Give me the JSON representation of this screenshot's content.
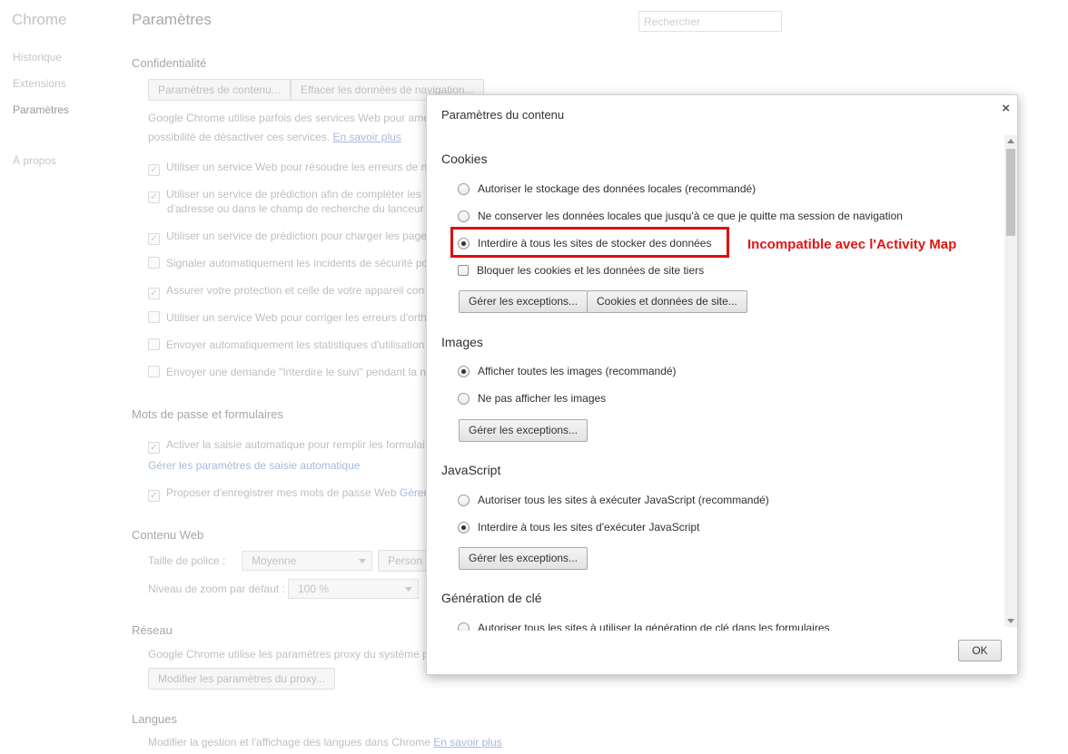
{
  "sidebar": {
    "title": "Chrome",
    "items": [
      {
        "label": "Historique"
      },
      {
        "label": "Extensions"
      },
      {
        "label": "Paramètres"
      },
      {
        "label": "À propos"
      }
    ]
  },
  "header": {
    "title": "Paramètres",
    "search_placeholder": "Rechercher"
  },
  "privacy": {
    "title": "Confidentialité",
    "content_settings_btn": "Paramètres de contenu...",
    "clear_data_btn": "Effacer les données de navigation...",
    "desc_line1": "Google Chrome utilise parfois des services Web pour amé",
    "desc_line2": "possibilité de désactiver ces services.",
    "learn_more": "En savoir plus",
    "checkboxes": [
      {
        "label": "Utiliser un service Web pour résoudre les erreurs de n",
        "checked": true
      },
      {
        "label": "Utiliser un service de prédiction afin de compléter les",
        "label2": "d'adresse ou dans le champ de recherche du lanceur d'",
        "checked": true
      },
      {
        "label": "Utiliser un service de prédiction pour charger les page",
        "checked": true
      },
      {
        "label": "Signaler automatiquement les incidents de sécurité po",
        "checked": false
      },
      {
        "label": "Assurer votre protection et celle de votre appareil con",
        "checked": true
      },
      {
        "label": "Utiliser un service Web pour corriger les erreurs d'orth",
        "checked": false
      },
      {
        "label": "Envoyer automatiquement les statistiques d'utilisation",
        "checked": false
      },
      {
        "label": "Envoyer une demande \"Interdire le suivi\" pendant la n",
        "checked": false
      }
    ]
  },
  "passwords": {
    "title": "Mots de passe et formulaires",
    "autofill_label": "Activer la saisie automatique pour remplir les formulai",
    "autofill_link": "Gérer les paramètres de saisie automatique",
    "save_pw_label": "Proposer d'enregistrer mes mots de passe Web",
    "save_pw_link": "Gérer"
  },
  "webcontent": {
    "title": "Contenu Web",
    "font_size_label": "Taille de police :",
    "font_size_value": "Moyenne",
    "custom_btn": "Person",
    "zoom_label": "Niveau de zoom par défaut :",
    "zoom_value": "100 %"
  },
  "network": {
    "title": "Réseau",
    "desc": "Google Chrome utilise les paramètres proxy du système p",
    "proxy_btn": "Modifier les paramètres du proxy..."
  },
  "languages": {
    "title": "Langues",
    "desc": "Modifier la gestion et l'affichage des langues dans Chrome",
    "link": "En savoir plus"
  },
  "dialog": {
    "title": "Paramètres du contenu",
    "close_glyph": "×",
    "ok_label": "OK",
    "cookies": {
      "title": "Cookies",
      "options": [
        {
          "label": "Autoriser le stockage des données locales (recommandé)",
          "selected": false
        },
        {
          "label": "Ne conserver les données locales que jusqu'à ce que je quitte ma session de navigation",
          "selected": false
        },
        {
          "label": "Interdire à tous les sites de stocker des données",
          "selected": true
        }
      ],
      "block_third_party": "Bloquer les cookies et les données de site tiers",
      "block_third_party_checked": false,
      "exceptions_btn": "Gérer les exceptions...",
      "site_data_btn": "Cookies et données de site..."
    },
    "images": {
      "title": "Images",
      "options": [
        {
          "label": "Afficher toutes les images (recommandé)",
          "selected": true
        },
        {
          "label": "Ne pas afficher les images",
          "selected": false
        }
      ],
      "exceptions_btn": "Gérer les exceptions..."
    },
    "javascript": {
      "title": "JavaScript",
      "options": [
        {
          "label": "Autoriser tous les sites à exécuter JavaScript (recommandé)",
          "selected": false
        },
        {
          "label": "Interdire à tous les sites d'exécuter JavaScript",
          "selected": true
        }
      ],
      "exceptions_btn": "Gérer les exceptions..."
    },
    "keygen": {
      "title": "Génération de clé",
      "partial_option": "Autoriser tous les sites à utiliser la génération de clé dans les formulaires"
    }
  },
  "annotation": {
    "text": "Incompatible avec l'Activity Map",
    "color": "#e41414"
  }
}
